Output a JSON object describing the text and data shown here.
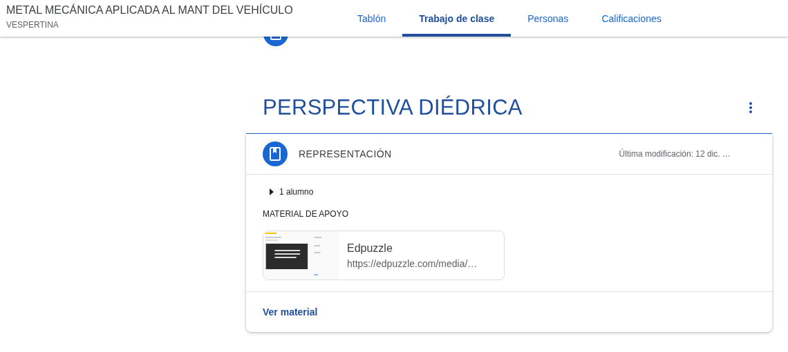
{
  "header": {
    "course_title": "METAL MECÁNICA APLICADA AL MANT DEL VEHÍCULO",
    "section": "VESPERTINA",
    "tabs": [
      {
        "label": "Tablón",
        "selected": false
      },
      {
        "label": "Trabajo de clase",
        "selected": true
      },
      {
        "label": "Personas",
        "selected": false
      },
      {
        "label": "Calificaciones",
        "selected": false
      }
    ]
  },
  "topic": {
    "title": "PERSPECTIVA DIÉDRICA",
    "material": {
      "title": "REPRESENTACIÓN",
      "modified": "Última modificación: 12 dic. …",
      "students": "1 alumno",
      "expanded": false,
      "section_label": "MATERIAL DE APOYO",
      "attachment": {
        "kind": "picture",
        "title": "Edpuzzle",
        "url": "https://edpuzzle.com/media/…"
      },
      "action": "Ver material"
    }
  }
}
